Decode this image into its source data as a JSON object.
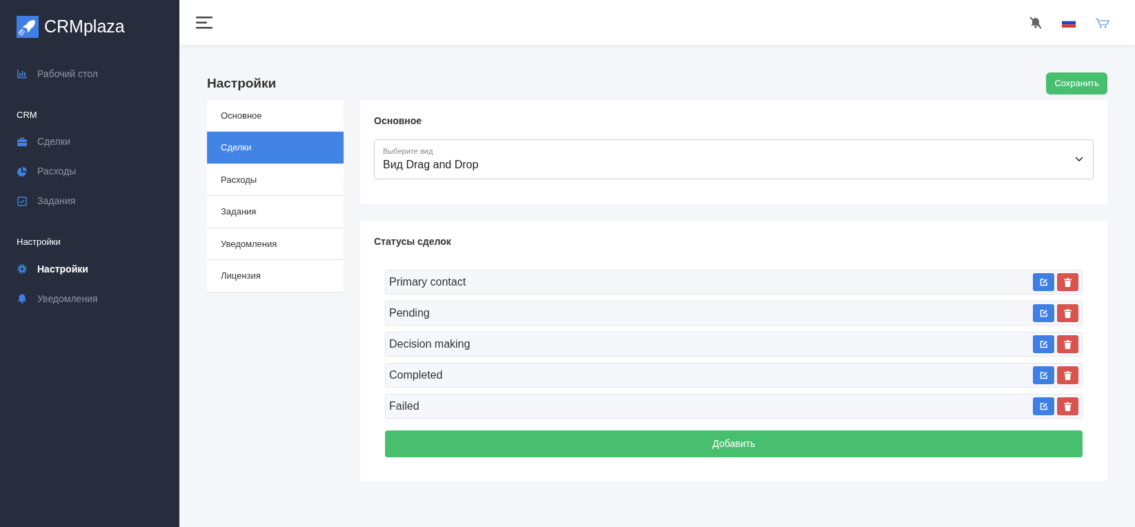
{
  "brand": {
    "name": "CRMplaza"
  },
  "sidebar": {
    "sections": [
      {
        "items": [
          {
            "label": "Рабочий стол",
            "selected": false
          }
        ]
      },
      {
        "heading": "CRM",
        "items": [
          {
            "label": "Сделки",
            "selected": false
          },
          {
            "label": "Расходы",
            "selected": false
          },
          {
            "label": "Задания",
            "selected": false
          }
        ]
      },
      {
        "heading": "Настройки",
        "items": [
          {
            "label": "Настройки",
            "selected": true
          },
          {
            "label": "Уведомления",
            "selected": false
          }
        ]
      }
    ]
  },
  "page": {
    "title": "Настройки",
    "save_button": "Сохранить"
  },
  "settings_tabs": [
    {
      "label": "Основное",
      "selected": false
    },
    {
      "label": "Сделки",
      "selected": true
    },
    {
      "label": "Расходы",
      "selected": false
    },
    {
      "label": "Задания",
      "selected": false
    },
    {
      "label": "Уведомления",
      "selected": false
    },
    {
      "label": "Лицензия",
      "selected": false
    }
  ],
  "general": {
    "title": "Основное",
    "view_select": {
      "label": "Выберите вид",
      "value": "Вид Drag and Drop"
    }
  },
  "statuses": {
    "title": "Статусы сделок",
    "items": [
      {
        "name": "Primary contact"
      },
      {
        "name": "Pending"
      },
      {
        "name": "Decision making"
      },
      {
        "name": "Completed"
      },
      {
        "name": "Failed"
      }
    ],
    "add_button": "Добавить"
  }
}
